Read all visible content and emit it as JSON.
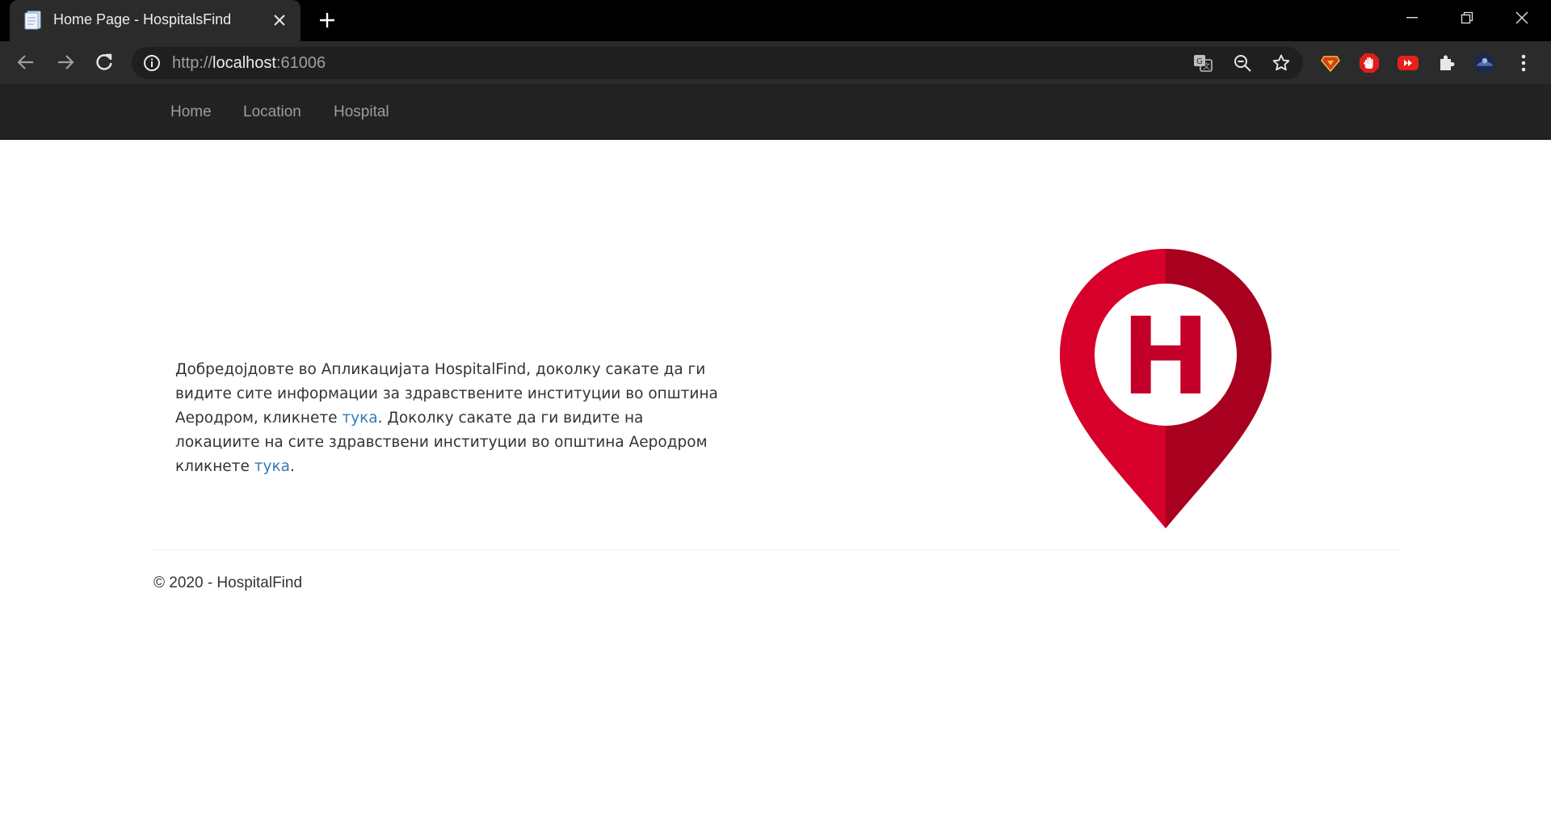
{
  "browser": {
    "tab_title": "Home Page - HospitalsFind",
    "url_scheme": "http://",
    "url_host": "localhost",
    "url_port": ":61006"
  },
  "site_nav": {
    "items": [
      {
        "label": "Home"
      },
      {
        "label": "Location"
      },
      {
        "label": "Hospital"
      }
    ]
  },
  "main": {
    "intro_part1": "Добредојдовте во Апликацијата HospitalFind, доколку сакате да ги видите сите информации за здравствените институции во општина Аеродром, кликнете ",
    "link1": "тука",
    "intro_part2": ". Доколку сакате да ги видите на локациите на сите здравствени институции во општина Аеродром кликнете ",
    "link2": "тука",
    "intro_part3": ".",
    "logo_letter": "H",
    "logo_colors": {
      "left": "#d6002a",
      "right": "#a8001f",
      "inner": "#ffffff",
      "letter": "#c4002a"
    }
  },
  "footer": {
    "text": "© 2020 - HospitalFind"
  },
  "icons": {
    "tab": "document-favicon-icon",
    "back": "back-arrow-icon",
    "forward": "forward-arrow-icon",
    "reload": "reload-icon",
    "site_info": "info-icon",
    "translate": "translate-icon",
    "zoom": "zoom-out-icon",
    "bookmark": "star-icon",
    "extensions": [
      "superman-extension-icon",
      "hand-stop-extension-icon",
      "youtube-extension-icon",
      "puzzle-extensions-icon"
    ],
    "profile": "profile-avatar-icon",
    "menu": "kebab-menu-icon"
  }
}
